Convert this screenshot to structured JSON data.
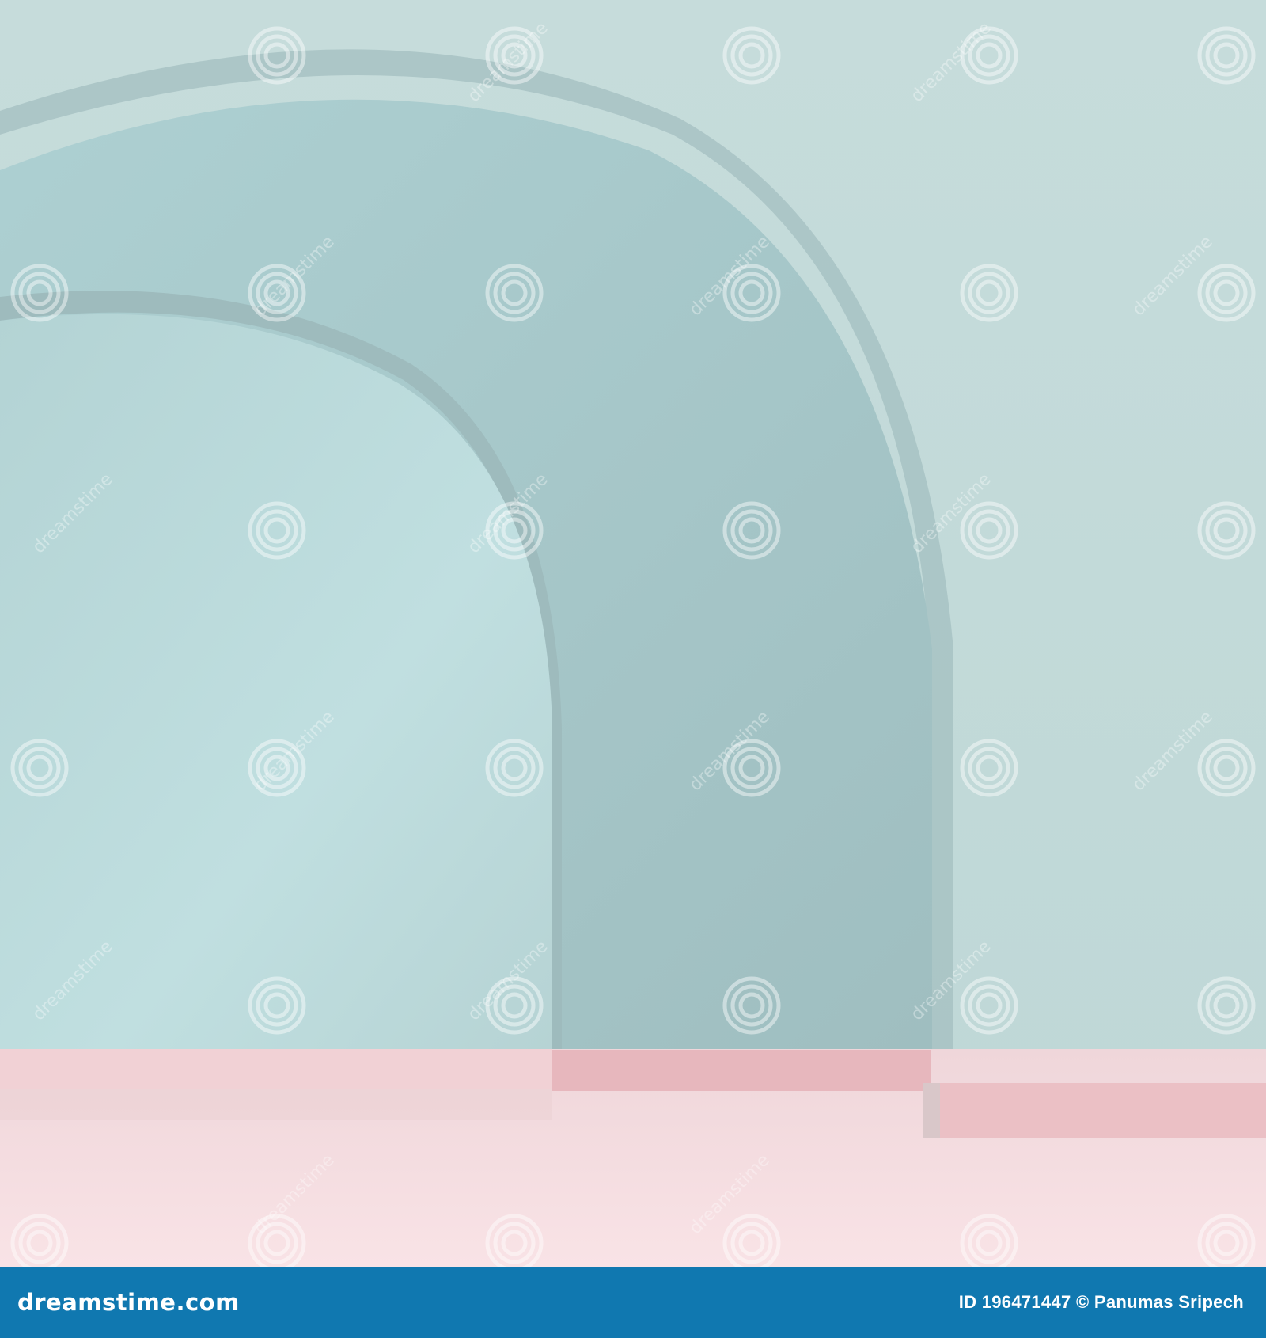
{
  "image": {
    "subject": "pastel 3D render of nested arches",
    "colors": {
      "back_wall": "#c2d9d8",
      "outer_arch_face": "#a7c7c9",
      "inner_arch_face": "#bcdadb",
      "arch_edge": "#8faeb1",
      "floor": "#f3d9dc",
      "baseboard": "#e9b9bf",
      "footer_bg": "#1078b0"
    }
  },
  "watermark": {
    "tile_text": "dreamstime",
    "icon": "spiral-logo-icon"
  },
  "footer": {
    "brand": "dreamstime.com",
    "credit": "ID 196471447 © Panumas Sripech"
  }
}
